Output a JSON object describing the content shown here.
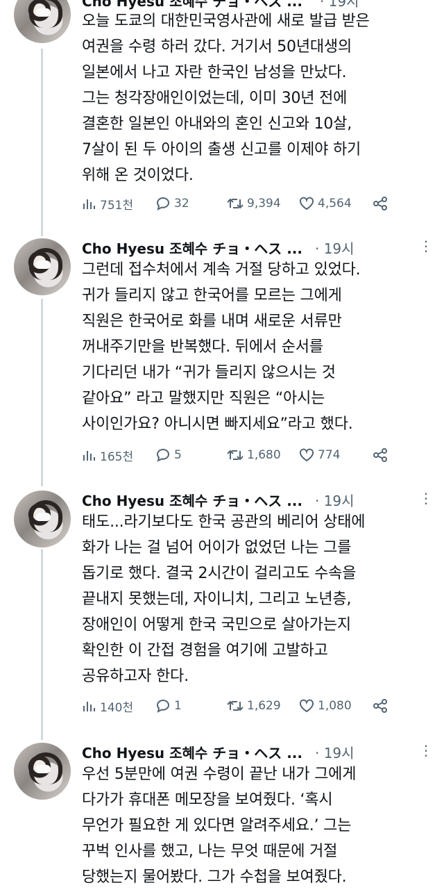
{
  "tweets": [
    {
      "author": "Cho Hyesu 조혜수 チョ・ヘス ...",
      "time": "· 19시",
      "text": "오늘 도쿄의 대한민국영사관에 새로 발급 받은\n여권을 수령 하러 갔다. 거기서 50년대생의\n일본에서 나고 자란 한국인 남성을 만났다.\n그는 청각장애인이었는데, 이미 30년 전에\n결혼한 일본인 아내와의 혼인 신고와 10살,\n7살이 된 두 아이의 출생 신고를 이제야 하기\n위해 온 것이었다.",
      "views": "751천",
      "replies": "32",
      "retweets": "9,394",
      "likes": "4,564"
    },
    {
      "author": "Cho Hyesu 조혜수 チョ・ヘス ...",
      "time": "· 19시",
      "text": "그런데 접수처에서 계속 거절 당하고 있었다.\n귀가 들리지 않고 한국어를 모르는 그에게\n직원은 한국어로 화를 내며 새로운 서류만\n꺼내주기만을 반복했다. 뒤에서 순서를\n기다리던 내가 “귀가 들리지 않으시는 것\n같아요” 라고 말했지만 직원은 “아시는\n사이인가요? 아니시면 빠지세요”라고 했다.",
      "views": "165천",
      "replies": "5",
      "retweets": "1,680",
      "likes": "774"
    },
    {
      "author": "Cho Hyesu 조혜수 チョ・ヘス ...",
      "time": "· 19시",
      "text": "태도...라기보다도 한국 공관의 베리어 상태에\n화가 나는 걸 넘어 어이가 없었던 나는 그를\n돕기로 했다. 결국 2시간이 걸리고도 수속을\n끝내지 못했는데, 자이니치, 그리고 노년층,\n장애인이 어떻게 한국 국민으로 살아가는지\n확인한 이 간접 경험을 여기에 고발하고\n공유하고자 한다.",
      "views": "140천",
      "replies": "1",
      "retweets": "1,629",
      "likes": "1,080"
    },
    {
      "author": "Cho Hyesu 조혜수 チョ・ヘス ...",
      "time": "· 19시",
      "text": "우선 5분만에 여권 수령이 끝난 내가 그에게\n다가가 휴대폰 메모장을 보여줬다. ‘혹시\n무언가 필요한 게 있다면 알려주세요.’ 그는\n꾸벅 인사를 했고, 나는 무엇 때문에 거절\n당했는지 물어봤다. 그가 수첩을 보여줬다."
    }
  ],
  "icons": {
    "views": "bar-chart-icon",
    "replies": "reply-bubble-icon",
    "retweets": "retweet-icon",
    "likes": "heart-icon",
    "share": "share-icon",
    "more": "more-vertical-icon"
  },
  "colors": {
    "text": "#0f1419",
    "muted": "#536471",
    "thread": "#cfd9de"
  }
}
